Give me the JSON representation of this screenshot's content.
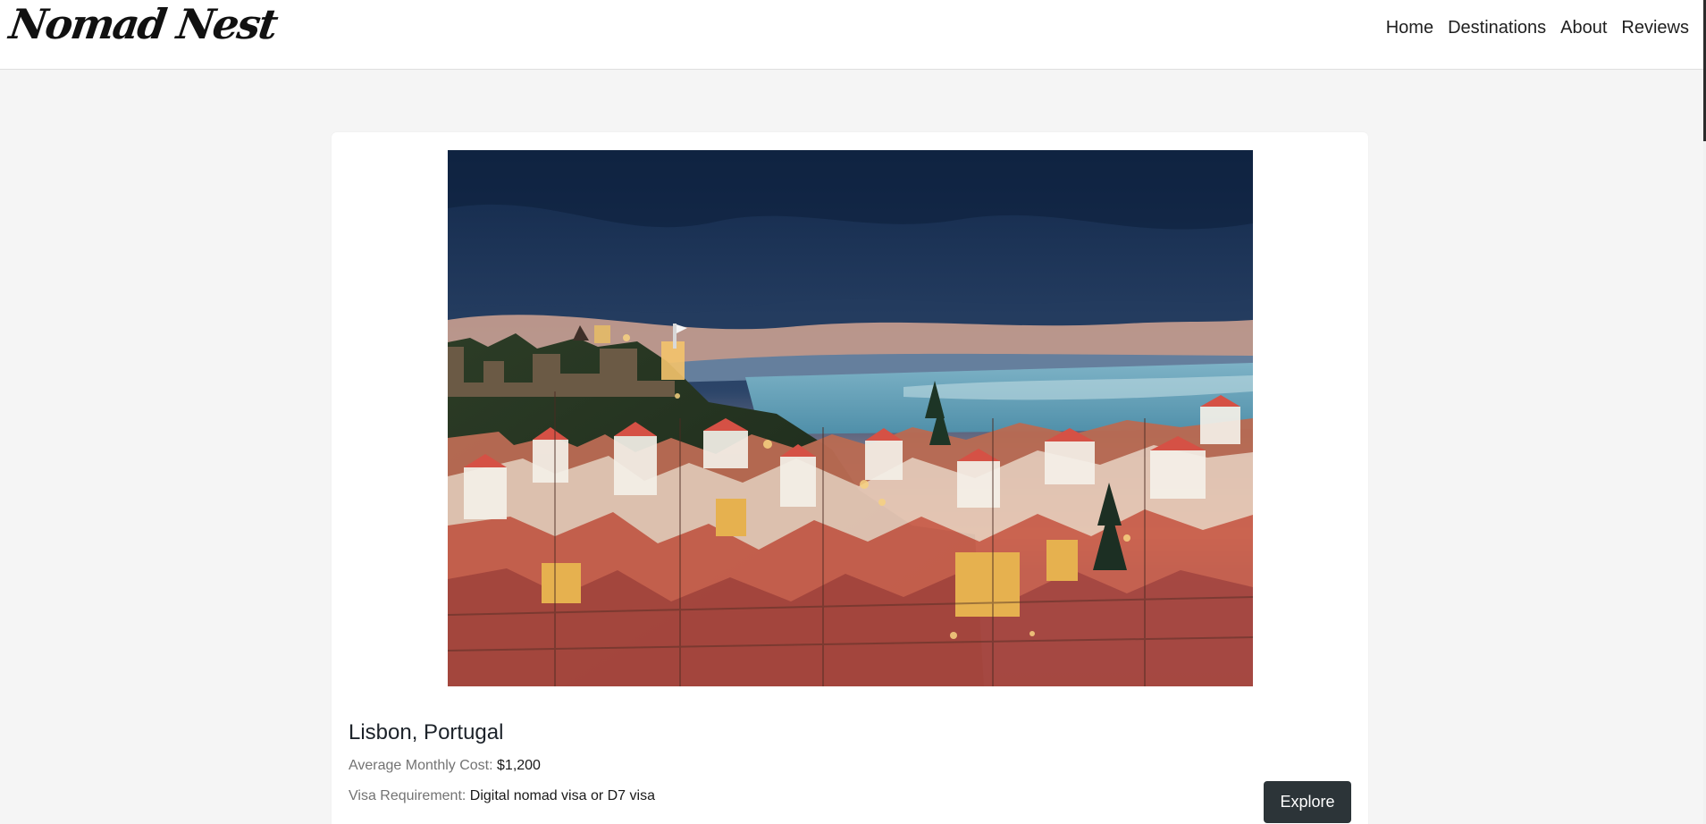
{
  "header": {
    "brand": "Nomad Nest",
    "nav": [
      {
        "label": "Home"
      },
      {
        "label": "Destinations"
      },
      {
        "label": "About"
      },
      {
        "label": "Reviews"
      }
    ]
  },
  "destination": {
    "image_alt": "Lisbon cityscape at dusk",
    "title": "Lisbon, Portugal",
    "cost_label": "Average Monthly Cost:",
    "cost_value": "$1,200",
    "visa_label": "Visa Requirement:",
    "visa_value": "Digital nomad visa or D7 visa",
    "button_label": "Explore"
  },
  "colors": {
    "page_background": "#f5f5f5",
    "card_background": "#ffffff",
    "button_background": "#2c3438",
    "button_text": "#ffffff",
    "muted_text": "#737373"
  }
}
